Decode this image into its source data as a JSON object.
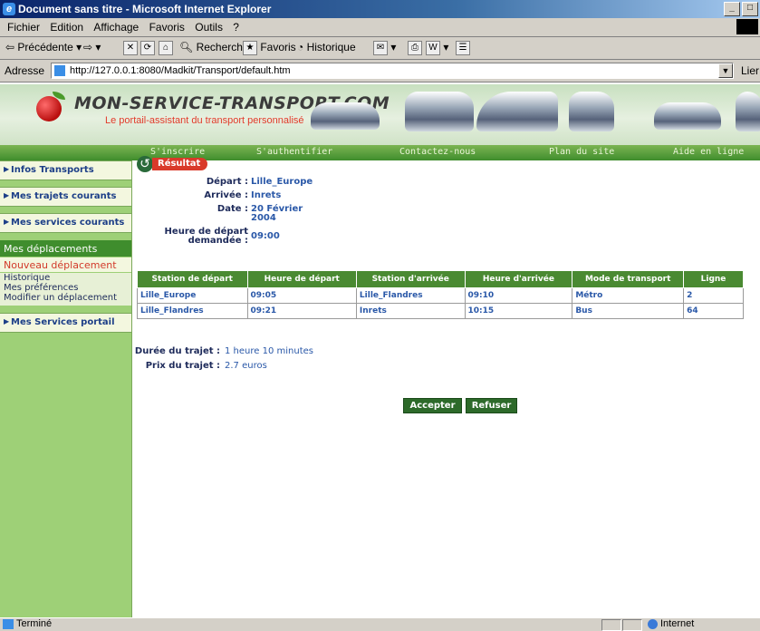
{
  "window": {
    "title": "Document sans titre - Microsoft Internet Explorer"
  },
  "menu": [
    "Fichier",
    "Edition",
    "Affichage",
    "Favoris",
    "Outils",
    "?"
  ],
  "toolbar": {
    "back": "Précédente",
    "search": "Rechercher",
    "favorites": "Favoris",
    "history": "Historique"
  },
  "address": {
    "label": "Adresse",
    "url": "http://127.0.0.1:8080/Madkit/Transport/default.htm",
    "links": "Lier"
  },
  "site": {
    "title": "MON-SERVICE-TRANSPORT.COM",
    "subtitle": "Le portail-assistant du transport personnalisé",
    "nav": [
      "S'inscrire",
      "S'authentifier",
      "Contactez-nous",
      "Plan du site",
      "Aide en ligne"
    ]
  },
  "sidebar": {
    "items": [
      "Infos Transports",
      "Mes trajets courants",
      "Mes services courants"
    ],
    "section": "Mes déplacements",
    "active_sub": "Nouveau déplacement",
    "links": [
      "Historique",
      "Mes préférences",
      "Modifier un déplacement"
    ],
    "portal": "Mes Services portail"
  },
  "result": {
    "badge": "Résultat",
    "depart_label": "Départ :",
    "depart": "Lille_Europe",
    "arrivee_label": "Arrivée :",
    "arrivee": "Inrets",
    "date_label": "Date :",
    "date_line1": "20 Février",
    "date_line2": "2004",
    "heure_label1": "Heure de départ",
    "heure_label2": "demandée :",
    "heure": "09:00"
  },
  "table": {
    "headers": [
      "Station de départ",
      "Heure de départ",
      "Station d'arrivée",
      "Heure d'arrivée",
      "Mode de transport",
      "Ligne"
    ],
    "rows": [
      [
        "Lille_Europe",
        "09:05",
        "Lille_Flandres",
        "09:10",
        "Métro",
        "2"
      ],
      [
        "Lille_Flandres",
        "09:21",
        "Inrets",
        "10:15",
        "Bus",
        "64"
      ]
    ]
  },
  "summary": {
    "duree_label": "Durée du trajet :",
    "duree": "1 heure 10 minutes",
    "prix_label": "Prix du trajet :",
    "prix": "2.7 euros"
  },
  "buttons": {
    "accept": "Accepter",
    "refuse": "Refuser"
  },
  "status": {
    "text": "Terminé",
    "zone": "Internet"
  }
}
